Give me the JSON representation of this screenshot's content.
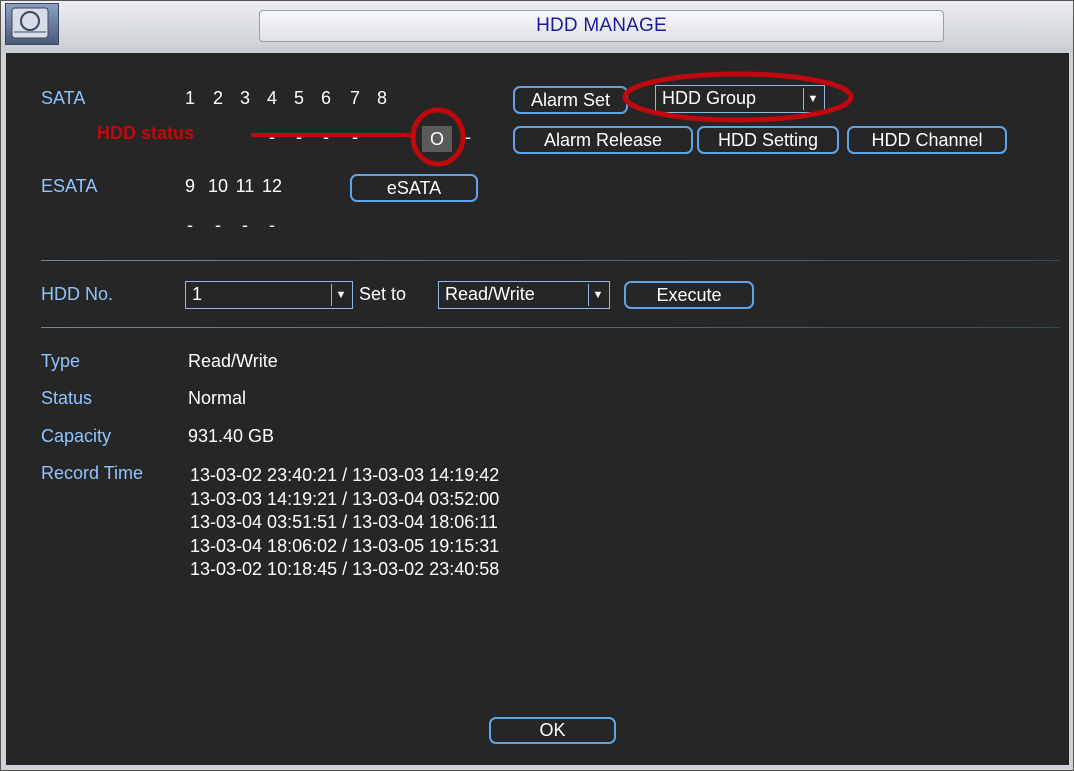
{
  "window": {
    "title": "HDD MANAGE"
  },
  "sata": {
    "label": "SATA",
    "ports": [
      "1",
      "2",
      "3",
      "4",
      "5",
      "6",
      "7",
      "8"
    ],
    "statuses": [
      "-",
      "-",
      "-",
      "-",
      "-",
      "-",
      "O",
      "-"
    ]
  },
  "esata": {
    "label": "ESATA",
    "ports": [
      "9",
      "10",
      "11",
      "12"
    ],
    "statuses": [
      "-",
      "-",
      "-",
      "-"
    ],
    "button_label": "eSATA"
  },
  "buttons": {
    "alarm_set": "Alarm Set",
    "alarm_release": "Alarm Release",
    "hdd_setting": "HDD Setting",
    "hdd_channel": "HDD Channel",
    "execute": "Execute",
    "ok": "OK"
  },
  "hdd_group_select": {
    "selected": "HDD Group"
  },
  "annotation": {
    "label": "HDD status",
    "color": "#c0080f"
  },
  "hdd_no": {
    "label": "HDD No.",
    "selected": "1",
    "set_to_label": "Set to",
    "set_to_selected": "Read/Write"
  },
  "info": {
    "type_label": "Type",
    "type_value": "Read/Write",
    "status_label": "Status",
    "status_value": "Normal",
    "capacity_label": "Capacity",
    "capacity_value": "931.40 GB",
    "record_time_label": "Record Time",
    "record_times": [
      "13-03-02 23:40:21 / 13-03-03 14:19:42",
      "13-03-03 14:19:21 / 13-03-04 03:52:00",
      "13-03-04 03:51:51 / 13-03-04 18:06:11",
      "13-03-04 18:06:02 / 13-03-05 19:15:31",
      "13-03-02 10:18:45 / 13-03-02 23:40:58"
    ]
  },
  "colors": {
    "background": "#262626",
    "label_blue": "#8fc4ff",
    "button_border": "#5fa4e6",
    "title_text": "#1a1aa0"
  }
}
